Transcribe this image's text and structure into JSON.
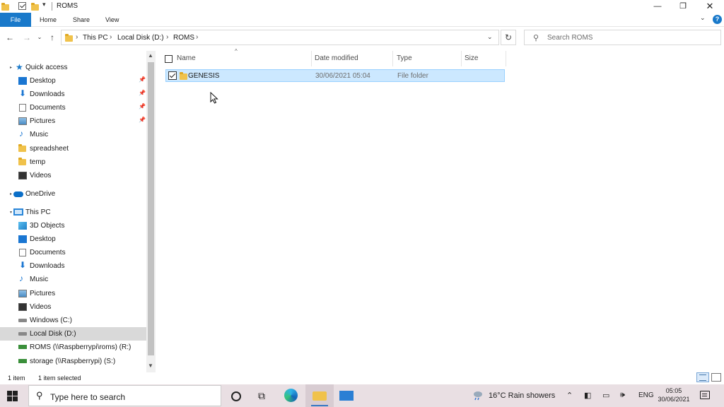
{
  "window": {
    "title": "ROMS",
    "minimize_glyph": "—",
    "restore_glyph": "❐",
    "close_glyph": "✕"
  },
  "ribbon": {
    "tabs": [
      "File",
      "Home",
      "Share",
      "View"
    ],
    "help_label": "?"
  },
  "address": {
    "crumbs": [
      "This PC",
      "Local Disk (D:)",
      "ROMS"
    ],
    "separator": "›",
    "search_placeholder": "Search ROMS"
  },
  "sidebar": {
    "items": [
      {
        "label": "Quick access",
        "icon": "star-icon"
      },
      {
        "label": "Desktop",
        "icon": "desktop-icon",
        "pinned": true
      },
      {
        "label": "Downloads",
        "icon": "downloads-icon",
        "pinned": true
      },
      {
        "label": "Documents",
        "icon": "documents-icon",
        "pinned": true
      },
      {
        "label": "Pictures",
        "icon": "pictures-icon",
        "pinned": true
      },
      {
        "label": "Music",
        "icon": "music-icon"
      },
      {
        "label": "spreadsheet",
        "icon": "folder-icon"
      },
      {
        "label": "temp",
        "icon": "folder-icon"
      },
      {
        "label": "Videos",
        "icon": "videos-icon"
      },
      {
        "label": "OneDrive",
        "icon": "onedrive-icon"
      },
      {
        "label": "This PC",
        "icon": "this-pc-icon"
      },
      {
        "label": "3D Objects",
        "icon": "3d-objects-icon"
      },
      {
        "label": "Desktop",
        "icon": "desktop-icon"
      },
      {
        "label": "Documents",
        "icon": "documents-icon"
      },
      {
        "label": "Downloads",
        "icon": "downloads-icon"
      },
      {
        "label": "Music",
        "icon": "music-icon"
      },
      {
        "label": "Pictures",
        "icon": "pictures-icon"
      },
      {
        "label": "Videos",
        "icon": "videos-icon"
      },
      {
        "label": "Windows (C:)",
        "icon": "drive-icon"
      },
      {
        "label": "Local Disk (D:)",
        "icon": "drive-icon",
        "selected": true
      },
      {
        "label": "ROMS (\\\\Raspberrypi\\roms) (R:)",
        "icon": "network-drive-icon"
      },
      {
        "label": "storage (\\\\Raspberrypi) (S:)",
        "icon": "network-drive-icon"
      }
    ]
  },
  "columns": [
    "Name",
    "Date modified",
    "Type",
    "Size"
  ],
  "files": [
    {
      "name": "GENESIS",
      "date": "30/06/2021 05:04",
      "type": "File folder",
      "size": "",
      "selected": true
    }
  ],
  "status": {
    "count": "1 item",
    "selection": "1 item selected"
  },
  "taskbar": {
    "search_placeholder": "Type here to search",
    "weather": "16°C  Rain showers",
    "language": "ENG",
    "time": "05:05",
    "date": "30/06/2021"
  },
  "colors": {
    "accent": "#1979ca",
    "selection": "#cce8ff",
    "taskbar": "#e9dfe3"
  }
}
